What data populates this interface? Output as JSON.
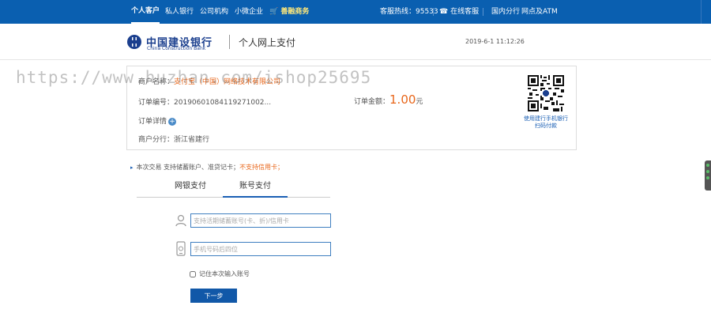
{
  "topnav": {
    "personal": "个人客户",
    "private": "私人银行",
    "corporate": "公司机构",
    "micro": "小微企业",
    "ecommerce": "善融商务",
    "hotline": "客服热线：95533",
    "online_service": "在线客服",
    "domestic_branch": "国内分行",
    "outlets_atm": "网点及ATM"
  },
  "brand": {
    "name_cn": "中国建设银行",
    "name_en": "China Construction Bank",
    "page_title": "个人网上支付",
    "datetime": "2019-6-1 11:12:26"
  },
  "order": {
    "merchant_label": "商户名称：",
    "merchant_value": "支付宝（中国）网络技术有限公司",
    "order_no_label": "订单编号：",
    "order_no_value": "20190601084119271002...",
    "amount_label": "订单金额：",
    "amount_value": "1.00",
    "amount_unit": "元",
    "details_label": "订单详情",
    "branch_label": "商户分行：",
    "branch_value": "浙江省建行",
    "qr_caption": "使用建行手机银行扫码付款"
  },
  "watermark": "https://www.huzhan.com/ishop25695",
  "notice": {
    "text": "本次交易 支持储蓄账户、准贷记卡；",
    "warning": "不支持信用卡；"
  },
  "tabs": [
    "网银支付",
    "账号支付"
  ],
  "form": {
    "account_placeholder": "支持活期储蓄账号(卡、折)/信用卡",
    "phone_placeholder": "手机号码后四位",
    "remember_label": "记住本次输入账号",
    "next_button": "下一步"
  },
  "colors": {
    "nav_blue": "#0a5fb0",
    "accent_orange": "#e8661a",
    "link_blue": "#1a5fb4"
  }
}
